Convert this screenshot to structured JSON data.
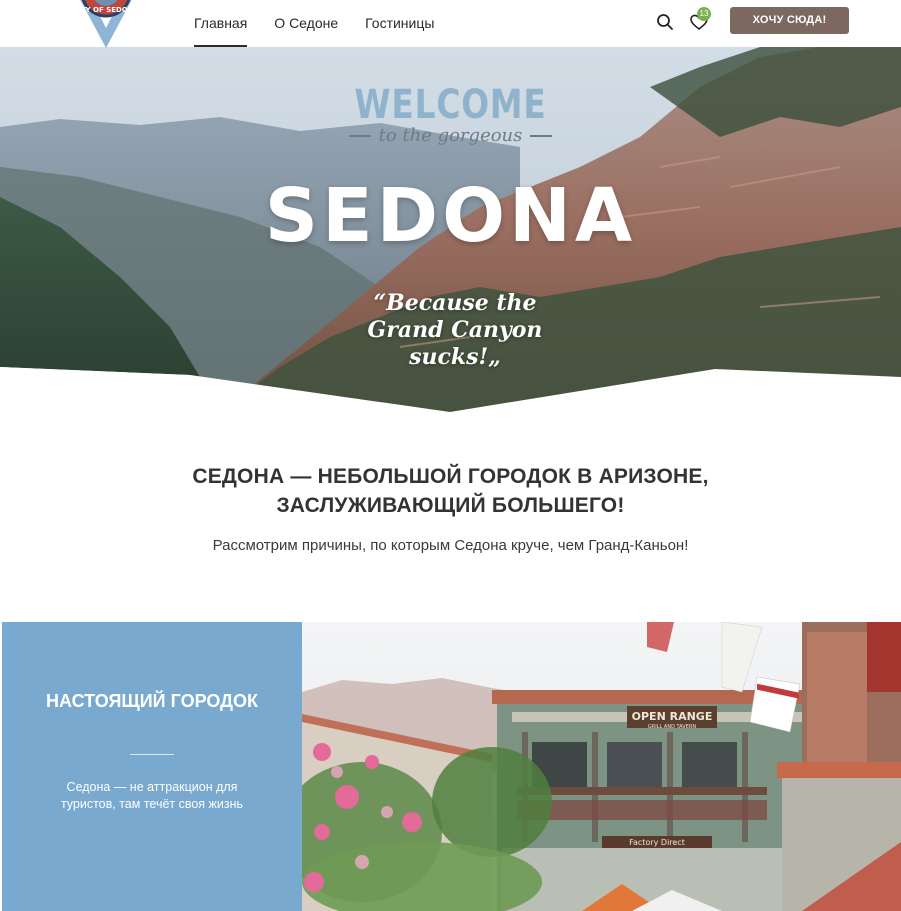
{
  "header": {
    "logo_text": "CITY OF SEDONA",
    "nav": [
      {
        "label": "Главная",
        "active": true
      },
      {
        "label": "О Седоне",
        "active": false
      },
      {
        "label": "Гостиницы",
        "active": false
      }
    ],
    "wishlist_count": "13",
    "cta_label": "ХОЧУ СЮДА!"
  },
  "hero": {
    "welcome": "WELCOME",
    "sub": "to the gorgeous",
    "title": "SEDONA",
    "quote": "“Because the Grand Canyon sucks!„"
  },
  "intro": {
    "title": "СЕДОНА — НЕБОЛЬШОЙ ГОРОДОК В АРИЗОНЕ, ЗАСЛУЖИВАЮЩИЙ БОЛЬШЕГО!",
    "subtitle": "Рассмотрим причины, по которым Седона круче, чем Гранд-Каньон!"
  },
  "feature": {
    "title": "НАСТОЯЩИЙ ГОРОДОК",
    "text": "Седона — не аттракцион для туристов, там течёт своя жизнь"
  },
  "photo": {
    "sign_text": "OPEN RANGE",
    "sign_sub": "GRILL AND TAVERN",
    "lower_sign": "Factory Direct"
  },
  "colors": {
    "accent_button": "#7d6861",
    "badge": "#78b24d",
    "feature_bg": "#79a9cf",
    "welcome_text": "#8fb3cc"
  }
}
